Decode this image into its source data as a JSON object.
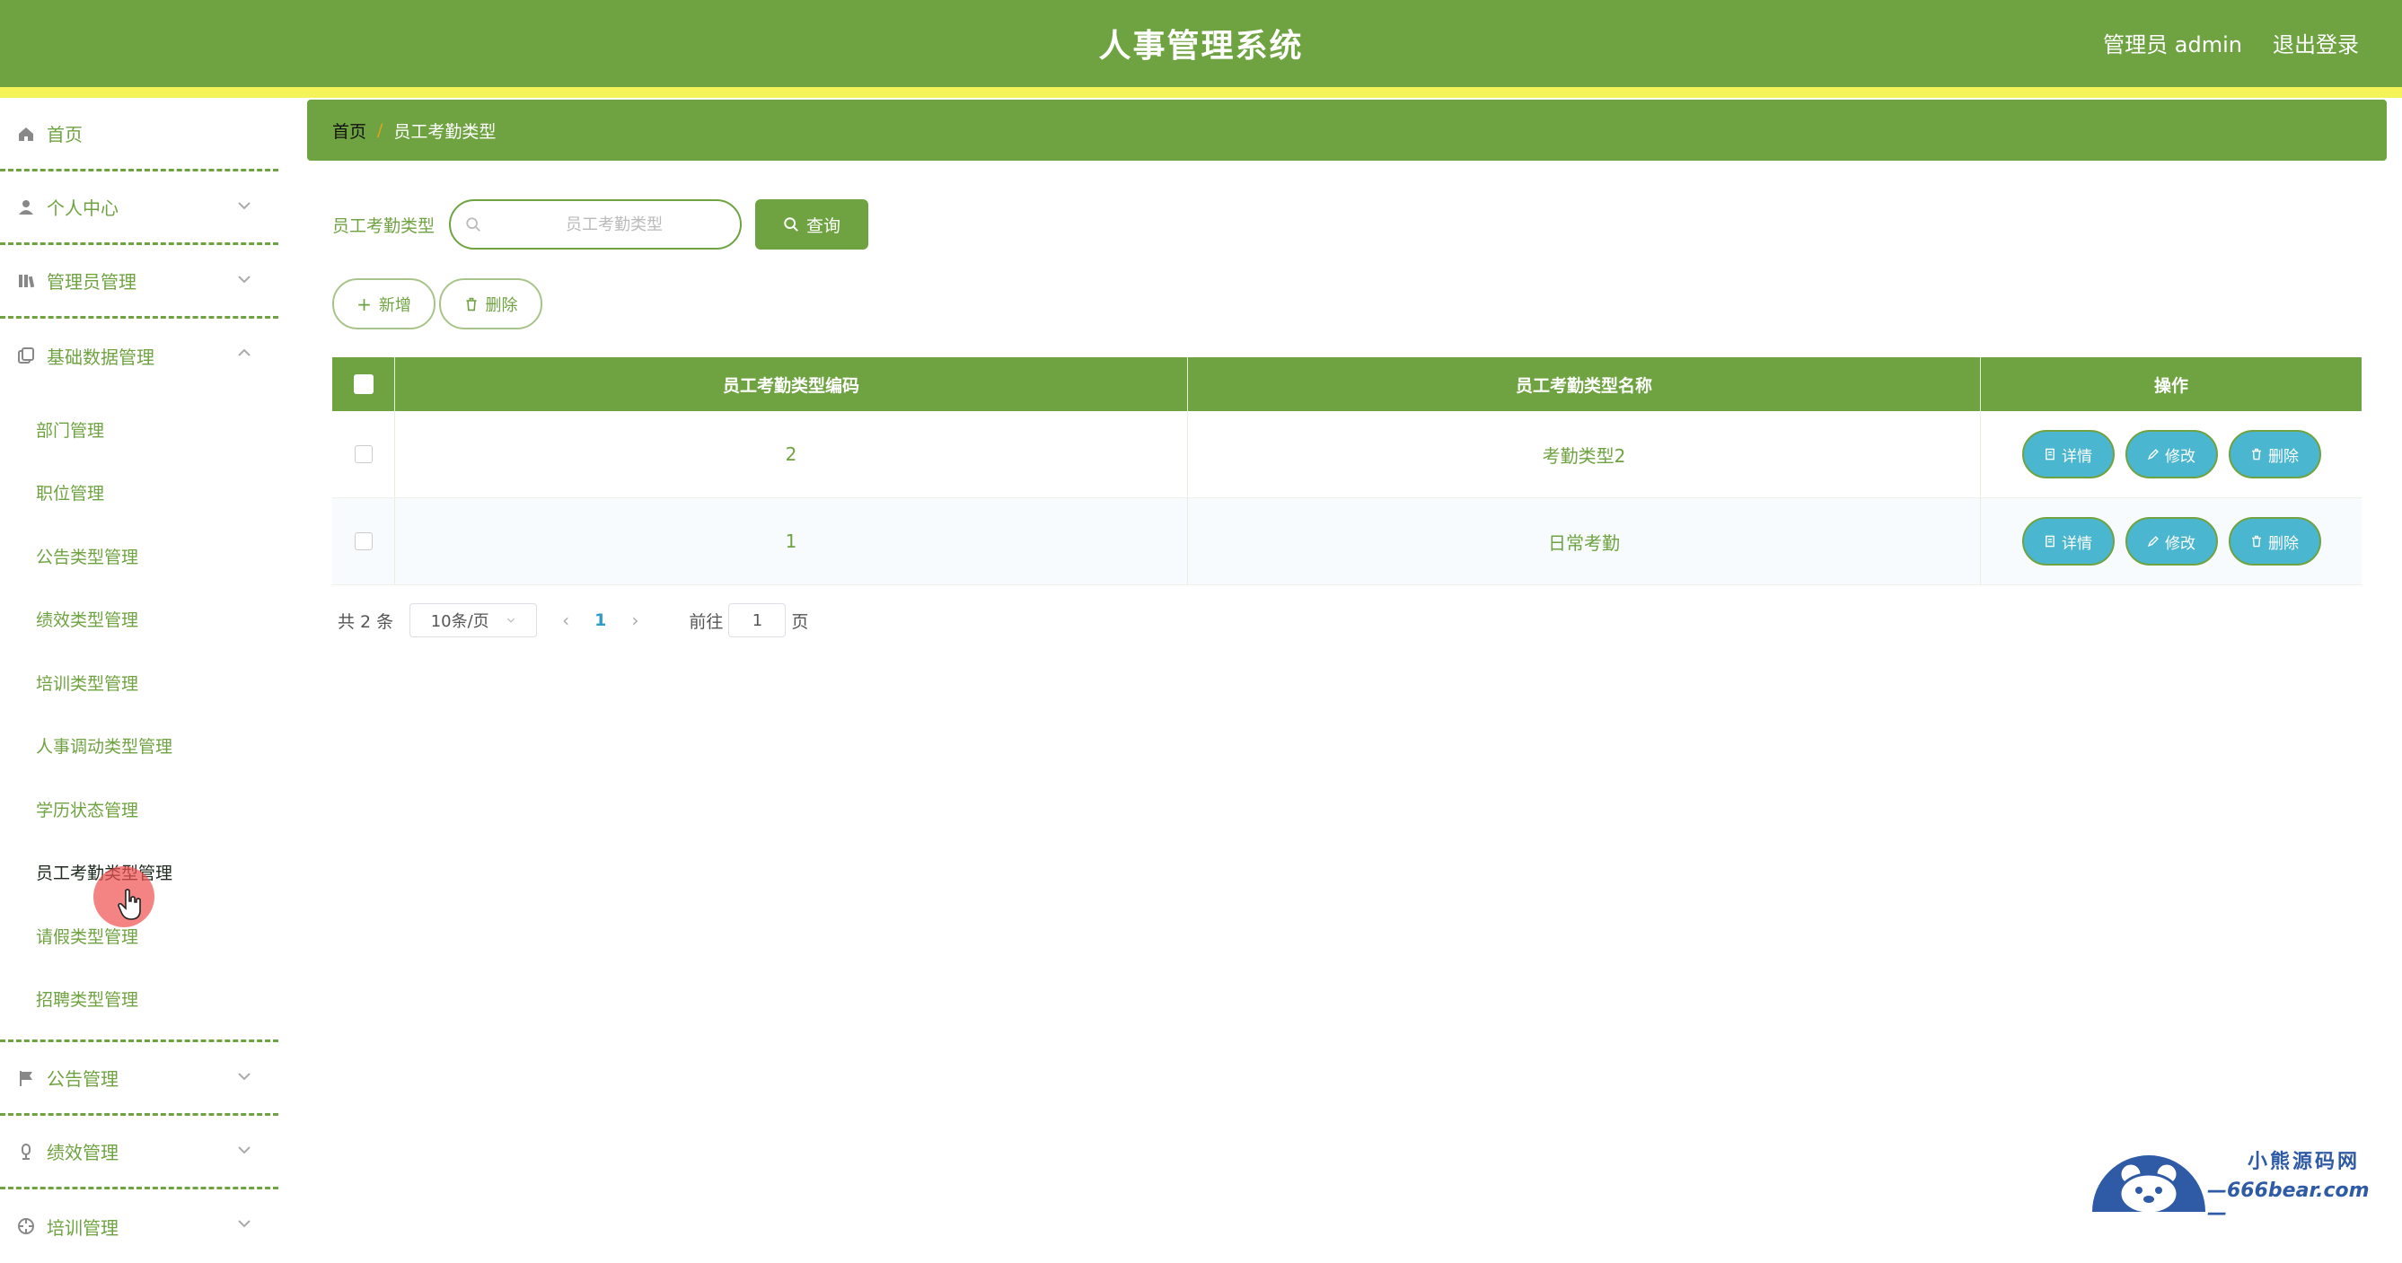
{
  "header": {
    "title": "人事管理系统",
    "user": "管理员 admin",
    "logout": "退出登录"
  },
  "sidebar": {
    "items": [
      {
        "label": "首页",
        "icon": "home-icon"
      },
      {
        "label": "个人中心",
        "icon": "user-icon"
      },
      {
        "label": "管理员管理",
        "icon": "admin-icon"
      },
      {
        "label": "基础数据管理",
        "icon": "copy-icon",
        "expanded": true
      },
      {
        "label": "公告管理",
        "icon": "flag-icon"
      },
      {
        "label": "绩效管理",
        "icon": "microphone-icon"
      },
      {
        "label": "培训管理",
        "icon": "target-icon"
      }
    ],
    "sub_items": [
      "部门管理",
      "职位管理",
      "公告类型管理",
      "绩效类型管理",
      "培训类型管理",
      "人事调动类型管理",
      "学历状态管理",
      "员工考勤类型管理",
      "请假类型管理",
      "招聘类型管理"
    ]
  },
  "breadcrumb": {
    "home": "首页",
    "separator": "/",
    "current": "员工考勤类型"
  },
  "search": {
    "label": "员工考勤类型",
    "placeholder": "员工考勤类型",
    "value": "",
    "button": "查询"
  },
  "actions": {
    "add": "新增",
    "delete": "删除"
  },
  "table": {
    "headers": [
      "员工考勤类型编码",
      "员工考勤类型名称",
      "操作"
    ],
    "rows": [
      {
        "code": "2",
        "name": "考勤类型2"
      },
      {
        "code": "1",
        "name": "日常考勤"
      }
    ],
    "row_actions": {
      "detail": "详情",
      "edit": "修改",
      "delete": "删除"
    }
  },
  "pagination": {
    "total": "共 2 条",
    "page_size": "10条/页",
    "current_page": "1",
    "goto_label": "前往",
    "goto_value": "1",
    "page_suffix": "页"
  },
  "watermark": {
    "line1": "小熊源码网",
    "line2": "—666bear.com—"
  },
  "colors": {
    "primary": "#6fa341",
    "strip": "#f5f35a",
    "op_button": "#4bb6cf",
    "breadcrumb_sep": "#e2a31d"
  }
}
